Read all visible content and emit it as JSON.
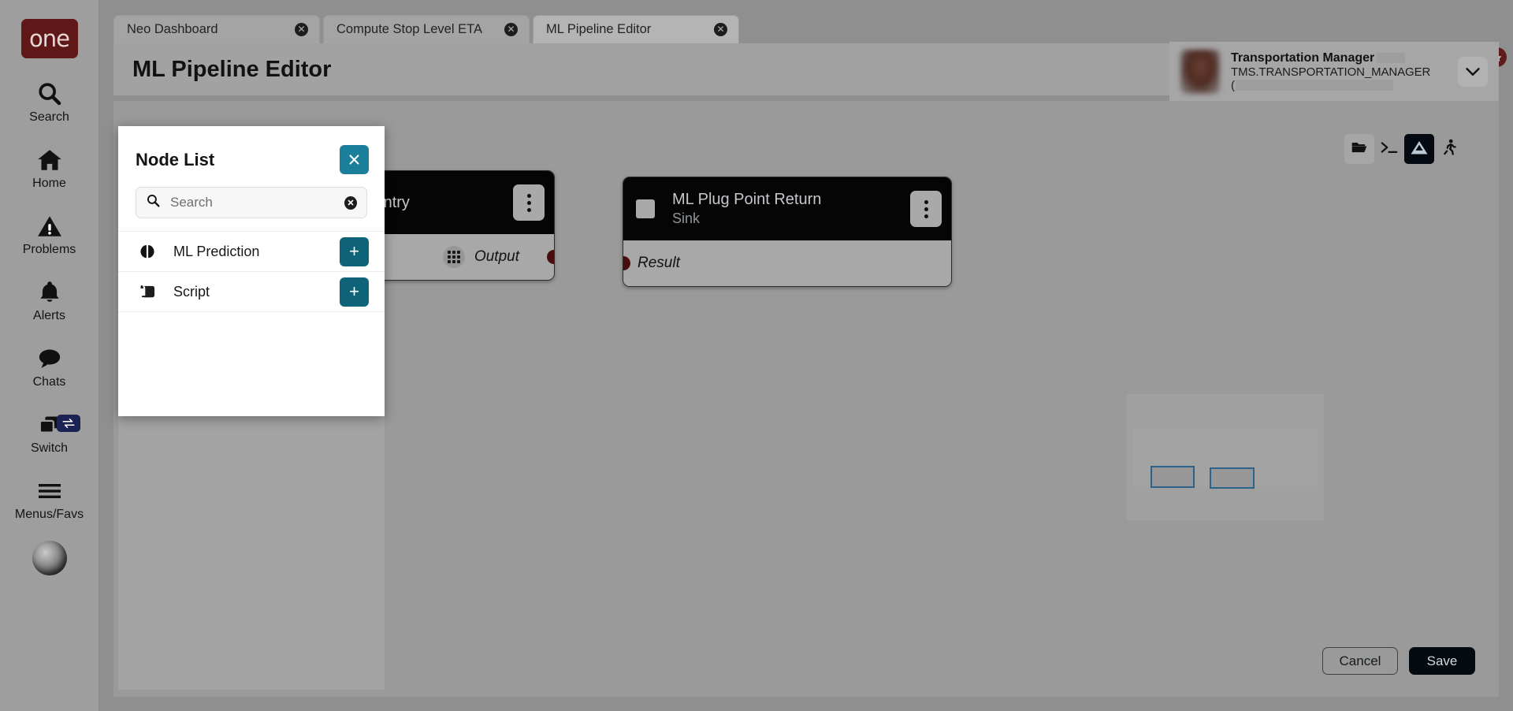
{
  "brand": {
    "logo_text": "one"
  },
  "rail": {
    "items": [
      {
        "label": "Search",
        "icon": "search-icon"
      },
      {
        "label": "Home",
        "icon": "home-icon"
      },
      {
        "label": "Problems",
        "icon": "warning-triangle-icon"
      },
      {
        "label": "Alerts",
        "icon": "bell-icon"
      },
      {
        "label": "Chats",
        "icon": "chat-bubble-icon"
      },
      {
        "label": "Switch",
        "icon": "windows-stack-icon",
        "badge_icon": "swap-arrows-icon"
      },
      {
        "label": "Menus/Favs",
        "icon": "hamburger-icon"
      }
    ]
  },
  "tabs": [
    {
      "label": "Neo Dashboard",
      "active": false,
      "close": "✕"
    },
    {
      "label": "Compute Stop Level ETA",
      "active": false,
      "close": "✕"
    },
    {
      "label": "ML Pipeline Editor",
      "active": true,
      "close": "✕"
    }
  ],
  "header": {
    "title": "ML Pipeline Editor",
    "actions": [
      {
        "name": "favorite-button",
        "icon": "star-icon"
      },
      {
        "name": "refresh-button",
        "icon": "refresh-icon"
      },
      {
        "name": "close-button",
        "icon": "close-icon"
      }
    ],
    "menu_badge_icon": "star-icon"
  },
  "user": {
    "role": "Transportation Manager",
    "login": "TMS.TRANSPORTATION_MANAGER",
    "org_prefix": "(",
    "caret": "⌄"
  },
  "canvas_toolbar": [
    {
      "name": "open-folder-button",
      "icon": "folder-open-icon",
      "state": "normal"
    },
    {
      "name": "console-button",
      "icon": "terminal-icon",
      "state": "normal"
    },
    {
      "name": "layout-button",
      "icon": "triangle-icon",
      "state": "active"
    },
    {
      "name": "run-button",
      "icon": "runner-icon",
      "state": "normal"
    }
  ],
  "nodes": [
    {
      "title": "nt Entry",
      "subtitle": "",
      "port_label": "Output",
      "port_side": "right",
      "has_grid_icon": true
    },
    {
      "title": "ML Plug Point Return",
      "subtitle": "Sink",
      "port_label": "Result",
      "port_side": "left",
      "has_grid_icon": false
    }
  ],
  "minimap": {
    "node_count": 2
  },
  "footer": {
    "cancel_label": "Cancel",
    "save_label": "Save"
  },
  "node_list_dialog": {
    "title": "Node List",
    "close_label": "✕",
    "search": {
      "value": "",
      "placeholder": "Search",
      "clear_label": "✕",
      "icon": "search-icon"
    },
    "items": [
      {
        "label": "ML Prediction",
        "icon": "brain-icon",
        "add_label": "+"
      },
      {
        "label": "Script",
        "icon": "scroll-icon",
        "add_label": "+"
      }
    ]
  },
  "colors": {
    "brand_maroon": "#5f1717",
    "accent_teal": "#0f6378",
    "close_teal": "#1b7e9b",
    "node_header": "#050505",
    "node_body": "#a8a8a8",
    "port_dot": "#4a0d0d",
    "minimap_outline": "#2b6389",
    "canvas_bg": "#9a9a9a"
  }
}
